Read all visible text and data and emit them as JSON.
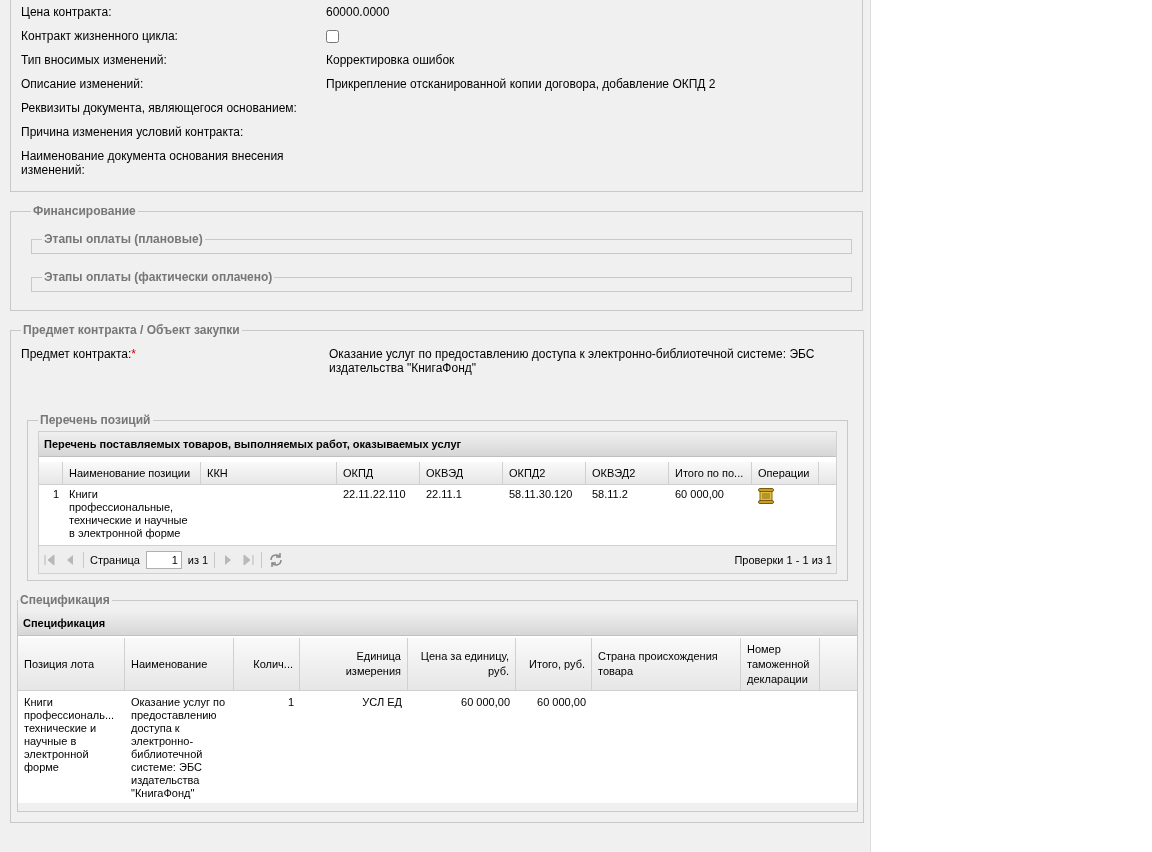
{
  "contract_fields": [
    {
      "label": "Цена контракта:",
      "kind": "text",
      "value": "60000.0000"
    },
    {
      "label": "Контракт жизненного цикла:",
      "kind": "checkbox",
      "checked": false
    },
    {
      "label": "Тип вносимых изменений:",
      "kind": "text",
      "value": "Корректировка ошибок"
    },
    {
      "label": "Описание изменений:",
      "kind": "text",
      "value": "Прикрепление отсканированной копии договора, добавление ОКПД 2"
    },
    {
      "label": "Реквизиты документа, являющегося основанием:",
      "kind": "text"
    },
    {
      "label": "Причина изменения условий контракта:",
      "kind": "text"
    },
    {
      "label": "Наименование документа основания внесения изменений:",
      "kind": "text"
    }
  ],
  "financing": {
    "legend": "Финансирование",
    "subsections": [
      {
        "legend": "Этапы оплаты (плановые)"
      },
      {
        "legend": "Этапы оплаты (фактически оплачено)"
      }
    ]
  },
  "subject": {
    "legend": "Предмет контракта / Объект закупки",
    "label": "Предмет контракта:",
    "required_mark": "*",
    "value": "Оказание услуг по предоставлению доступа к электронно-библиотечной системе: ЭБС издательства \"КнигаФонд\"",
    "positions": {
      "legend": "Перечень позиций",
      "grid_title": "Перечень поставляемых товаров, выполняемых работ, оказываемых услуг",
      "columns": [
        {
          "label": "Наименование позиции",
          "kind": "text"
        },
        {
          "label": "ККН",
          "kind": "text"
        },
        {
          "label": "ОКПД",
          "kind": "text"
        },
        {
          "label": "ОКВЭД",
          "kind": "text"
        },
        {
          "label": "ОКПД2",
          "kind": "text"
        },
        {
          "label": "ОКВЭД2",
          "kind": "text"
        },
        {
          "label": "Итого по по...",
          "kind": "text"
        },
        {
          "label": "Операции",
          "kind": "actions"
        }
      ],
      "rows": [
        {
          "number": "1",
          "cells": [
            "Книги профессиональные, технические и научные в электронной форме",
            null,
            "22.11.22.110",
            "22.11.1",
            "58.11.30.120",
            "58.11.2",
            "60 000,00",
            null
          ]
        }
      ],
      "pager": {
        "page_label": "Страница",
        "page": "1",
        "page_count": "из 1",
        "summary": "Проверки 1 - 1 из 1"
      }
    }
  },
  "specification": {
    "legend": "Спецификация",
    "grid_title": "Спецификация",
    "columns": [
      {
        "label": "Позиция лота"
      },
      {
        "label": "Наименование"
      },
      {
        "label": "Колич..."
      },
      {
        "label": "Единица измерения"
      },
      {
        "label": "Цена за единицу, руб."
      },
      {
        "label": "Итого, руб."
      },
      {
        "label": "Страна происхождения товара"
      },
      {
        "label": "Номер таможенной декларации"
      }
    ],
    "rows": [
      {
        "cells": [
          "Книги профессиональ... технические и научные в электронной форме",
          "Оказание услуг по предоставлению доступа к электронно-библиотечной системе: ЭБС издательства \"КнигаФонд\"",
          "1",
          "УСЛ ЕД",
          "60 000,00",
          "60 000,00",
          null,
          null
        ]
      }
    ]
  }
}
